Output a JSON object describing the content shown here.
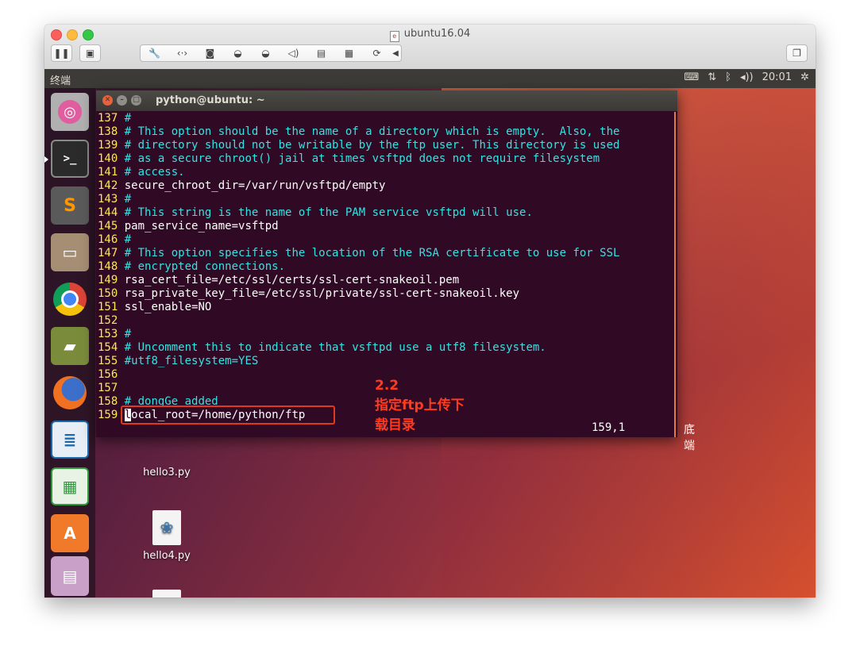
{
  "mac_window": {
    "title": "ubuntu16.04"
  },
  "toolbar": {
    "pause_icon": "pause-icon",
    "snapshot_icon": "snapshot-icon",
    "tools": [
      "wrench-icon",
      "network-icon",
      "disk-icon",
      "usb-icon",
      "usb-icon",
      "volume-icon",
      "lock-icon",
      "save-icon",
      "refresh-icon",
      "arrow-left-icon"
    ],
    "restore_icon": "restore-icon"
  },
  "ubuntu_topbar": {
    "app_name": "终端",
    "time": "20:01"
  },
  "launcher": {
    "items": [
      "ubuntu-dash",
      "terminal",
      "sublime-text",
      "files",
      "chrome",
      "book-reader",
      "firefox",
      "libreoffice-writer",
      "libreoffice-calc",
      "amazon",
      "workspace-stack"
    ],
    "sublime_glyph": "S",
    "amazon_glyph": "A"
  },
  "desktop_icons": [
    {
      "label": "hello3.py"
    },
    {
      "label": "hello4.py"
    }
  ],
  "terminal": {
    "title": "python@ubuntu: ~",
    "lines": [
      {
        "n": "137",
        "text": " #",
        "type": "cmt"
      },
      {
        "n": "138",
        "text": " # This option should be the name of a directory which is empty.  Also, the",
        "type": "cmt"
      },
      {
        "n": "139",
        "text": " # directory should not be writable by the ftp user. This directory is used",
        "type": "cmt"
      },
      {
        "n": "140",
        "text": " # as a secure chroot() jail at times vsftpd does not require filesystem",
        "type": "cmt"
      },
      {
        "n": "141",
        "text": " # access.",
        "type": "cmt"
      },
      {
        "n": "142",
        "text": " secure_chroot_dir=/var/run/vsftpd/empty",
        "type": "txt"
      },
      {
        "n": "143",
        "text": " #",
        "type": "cmt"
      },
      {
        "n": "144",
        "text": " # This string is the name of the PAM service vsftpd will use.",
        "type": "cmt"
      },
      {
        "n": "145",
        "text": " pam_service_name=vsftpd",
        "type": "txt"
      },
      {
        "n": "146",
        "text": " #",
        "type": "cmt"
      },
      {
        "n": "147",
        "text": " # This option specifies the location of the RSA certificate to use for SSL",
        "type": "cmt"
      },
      {
        "n": "148",
        "text": " # encrypted connections.",
        "type": "cmt"
      },
      {
        "n": "149",
        "text": " rsa_cert_file=/etc/ssl/certs/ssl-cert-snakeoil.pem",
        "type": "txt"
      },
      {
        "n": "150",
        "text": " rsa_private_key_file=/etc/ssl/private/ssl-cert-snakeoil.key",
        "type": "txt"
      },
      {
        "n": "151",
        "text": " ssl_enable=NO",
        "type": "txt"
      },
      {
        "n": "152",
        "text": "",
        "type": "txt"
      },
      {
        "n": "153",
        "text": " #",
        "type": "cmt"
      },
      {
        "n": "154",
        "text": " # Uncomment this to indicate that vsftpd use a utf8 filesystem.",
        "type": "cmt"
      },
      {
        "n": "155",
        "text": " #utf8_filesystem=YES",
        "type": "cmt"
      },
      {
        "n": "156",
        "text": "",
        "type": "txt"
      },
      {
        "n": "157",
        "text": "",
        "type": "txt"
      },
      {
        "n": "158",
        "text": " # dongGe added",
        "type": "cmt"
      }
    ],
    "cursor_line": {
      "n": "159",
      "cursor_char": "l",
      "rest": "ocal_root=/home/python/ftp"
    },
    "status_position": "159,1",
    "status_scroll": "底端"
  },
  "annotation": {
    "line1": "2.2",
    "line2": "指定ftp上传下",
    "line3": "载目录"
  }
}
